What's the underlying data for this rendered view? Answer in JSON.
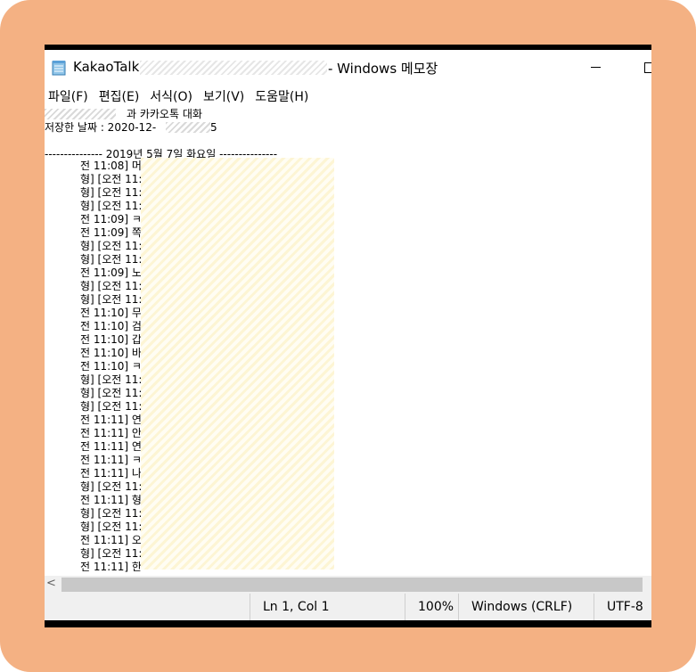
{
  "window": {
    "title_prefix": "KakaoTalk",
    "title_suffix": "- Windows 메모장"
  },
  "menu": [
    "파일(F)",
    "편집(E)",
    "서식(O)",
    "보기(V)",
    "도움말(H)"
  ],
  "document": {
    "header_line": "과 카카오톡 대화",
    "saved_prefix": "저장한 날짜 : 2020-12-",
    "saved_suffix": "5",
    "date_divider": "--------------- 2019년 5월 7일 화요일 ---------------",
    "lines": [
      "전 11:08] 머",
      "형] [오전 11:",
      "형] [오전 11:",
      "형] [오전 11:",
      "전 11:09] ㅋ",
      "전 11:09] 쪽",
      "형] [오전 11:",
      "형] [오전 11:",
      "전 11:09] 노",
      "형] [오전 11:",
      "형] [오전 11:",
      "전 11:10] 무",
      "전 11:10] 검",
      "전 11:10] 갑",
      "전 11:10] 바",
      "전 11:10] ㅋ",
      "형] [오전 11:",
      "형] [오전 11:",
      "형] [오전 11:",
      "전 11:11] 연",
      "전 11:11] 안",
      "전 11:11] 연",
      "전 11:11] ㅋ",
      "전 11:11] 나",
      "형] [오전 11:",
      "전 11:11] 형",
      "형] [오전 11:",
      "형] [오전 11:",
      "전 11:11] 오",
      "형] [오전 11:",
      "전 11:11] 한"
    ]
  },
  "status": {
    "position": "Ln 1, Col 1",
    "zoom": "100%",
    "line_ending": "Windows (CRLF)",
    "encoding": "UTF-8"
  },
  "scroll_left_glyph": "<"
}
